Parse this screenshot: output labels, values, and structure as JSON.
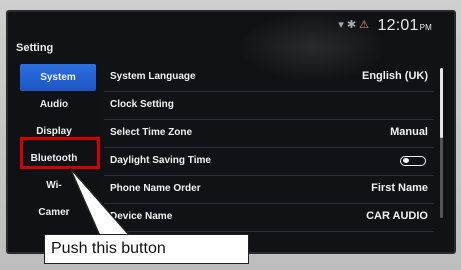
{
  "status": {
    "time": "12:01",
    "ampm": "PM"
  },
  "title": "Setting",
  "side_menu": [
    {
      "label": "System",
      "active": true
    },
    {
      "label": "Audio",
      "active": false
    },
    {
      "label": "Display",
      "active": false
    },
    {
      "label": "Bluetooth",
      "active": false
    },
    {
      "label": "Wi-",
      "active": false
    },
    {
      "label": "Camer",
      "active": false
    }
  ],
  "settings": [
    {
      "label": "System Language",
      "value": "English (UK)"
    },
    {
      "label": "Clock Setting",
      "value": ""
    },
    {
      "label": "Select Time Zone",
      "value": "Manual"
    },
    {
      "label": "Daylight Saving Time",
      "toggle": "off"
    },
    {
      "label": "Phone Name Order",
      "value": "First Name"
    },
    {
      "label": "Device Name",
      "value": "CAR AUDIO"
    }
  ],
  "annotation": {
    "text": "Push this button",
    "highlight_color": "#d40000"
  },
  "colors": {
    "active_tab": "#1d56c3",
    "screen_bg": "#101216"
  }
}
